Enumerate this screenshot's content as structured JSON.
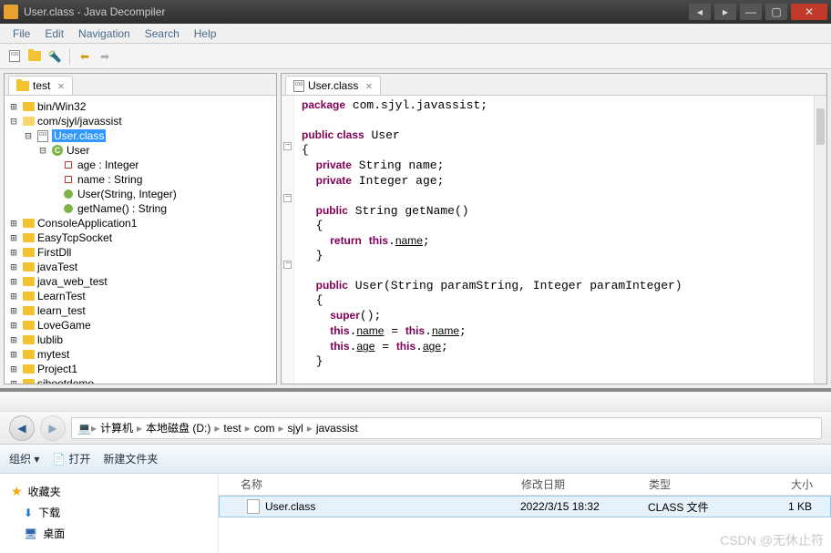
{
  "window": {
    "title": "User.class - Java Decompiler"
  },
  "menu": [
    "File",
    "Edit",
    "Navigation",
    "Search",
    "Help"
  ],
  "left_tab": {
    "label": "test"
  },
  "tree": {
    "root": [
      {
        "label": "bin/Win32",
        "type": "folder"
      },
      {
        "label": "com/sjyl/javassist",
        "type": "folder-open",
        "children": [
          {
            "label": "User.class",
            "type": "java",
            "selected": true,
            "children": [
              {
                "label": "User",
                "type": "class",
                "children": [
                  {
                    "label": "age : Integer",
                    "type": "field"
                  },
                  {
                    "label": "name : String",
                    "type": "field"
                  },
                  {
                    "label": "User(String, Integer)",
                    "type": "method"
                  },
                  {
                    "label": "getName() : String",
                    "type": "method"
                  }
                ]
              }
            ]
          }
        ]
      },
      {
        "label": "ConsoleApplication1",
        "type": "folder"
      },
      {
        "label": "EasyTcpSocket",
        "type": "folder"
      },
      {
        "label": "FirstDll",
        "type": "folder"
      },
      {
        "label": "javaTest",
        "type": "folder"
      },
      {
        "label": "java_web_test",
        "type": "folder"
      },
      {
        "label": "LearnTest",
        "type": "folder"
      },
      {
        "label": "learn_test",
        "type": "folder"
      },
      {
        "label": "LoveGame",
        "type": "folder"
      },
      {
        "label": "lublib",
        "type": "folder"
      },
      {
        "label": "mytest",
        "type": "folder"
      },
      {
        "label": "Project1",
        "type": "folder"
      },
      {
        "label": "sjbootdemo",
        "type": "folder"
      }
    ]
  },
  "editor_tab": {
    "label": "User.class"
  },
  "code": {
    "package": "package com.sjyl.javassist;",
    "class_decl": "public class User",
    "open": "{",
    "field1": "  private String name;",
    "field2": "  private Integer age;",
    "method1_sig": "  public String getName()",
    "m1_open": "  {",
    "m1_body": "    return this.name;",
    "m1_close": "  }",
    "method2_sig": "  public User(String paramString, Integer paramInteger)",
    "m2_open": "  {",
    "m2_l1": "    super();",
    "m2_l2": "    this.name = this.name;",
    "m2_l3": "    this.age = this.age;",
    "m2_close": "  }"
  },
  "explorer": {
    "breadcrumb": [
      "计算机",
      "本地磁盘 (D:)",
      "test",
      "com",
      "sjyl",
      "javassist"
    ],
    "toolbar": {
      "organize": "组织 ▾",
      "open": "打开",
      "new_folder": "新建文件夹"
    },
    "side": {
      "fav": "收藏夹",
      "downloads": "下载",
      "desktop": "桌面"
    },
    "columns": {
      "name": "名称",
      "date": "修改日期",
      "type": "类型",
      "size": "大小"
    },
    "row": {
      "name": "User.class",
      "date": "2022/3/15 18:32",
      "type": "CLASS 文件",
      "size": "1 KB"
    }
  },
  "watermark": "CSDN @无休止符"
}
